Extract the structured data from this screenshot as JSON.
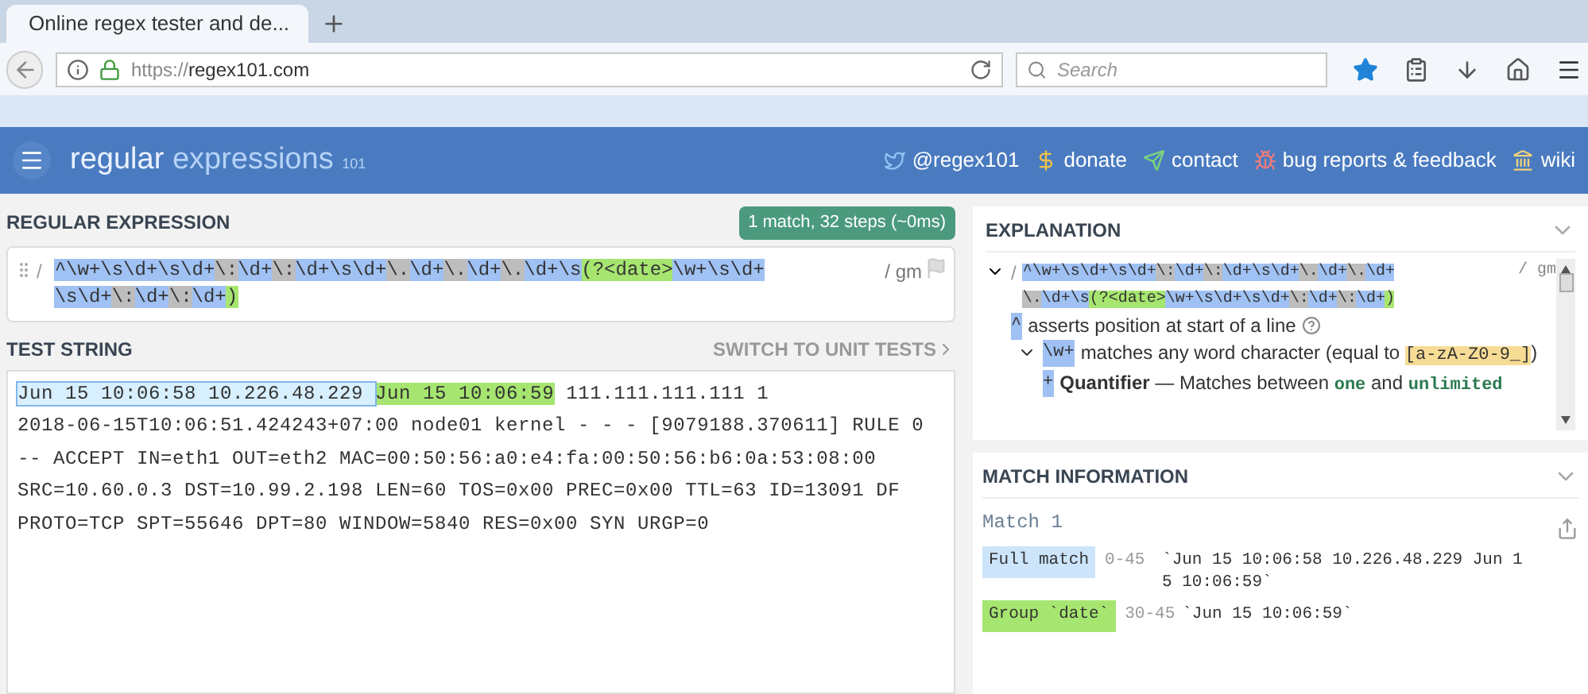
{
  "browser": {
    "tab_title": "Online regex tester and de...",
    "url_prefix": "https://",
    "url_host": "regex101.com",
    "search_placeholder": "Search"
  },
  "header": {
    "logo": [
      "regular",
      "expressions",
      "101"
    ],
    "links": [
      {
        "kind": "twitter",
        "label": "@regex101"
      },
      {
        "kind": "donate",
        "label": "donate"
      },
      {
        "kind": "contact",
        "label": "contact"
      },
      {
        "kind": "bug",
        "label": "bug reports & feedback"
      },
      {
        "kind": "wiki",
        "label": "wiki"
      }
    ]
  },
  "regex_panel": {
    "title": "REGULAR EXPRESSION",
    "status": "1 match, 32 steps (~0ms)",
    "delimiter": "/",
    "flags": "/ gm",
    "lines": [
      [
        {
          "kind": "token",
          "text": "^\\w+\\s\\d+\\s\\d+"
        },
        {
          "kind": "escape",
          "text": "\\:"
        },
        {
          "kind": "token",
          "text": "\\d+"
        },
        {
          "kind": "escape",
          "text": "\\:"
        },
        {
          "kind": "token",
          "text": "\\d+\\s\\d+"
        },
        {
          "kind": "escape",
          "text": "\\."
        },
        {
          "kind": "token",
          "text": "\\d+"
        },
        {
          "kind": "escape",
          "text": "\\."
        },
        {
          "kind": "token",
          "text": "\\d+"
        },
        {
          "kind": "escape",
          "text": "\\."
        },
        {
          "kind": "token",
          "text": "\\d+\\s"
        },
        {
          "kind": "group",
          "text": "(?<date>"
        },
        {
          "kind": "token",
          "text": "\\w+\\s\\d+"
        }
      ],
      [
        {
          "kind": "token",
          "text": "\\s\\d+"
        },
        {
          "kind": "escape",
          "text": "\\:"
        },
        {
          "kind": "token",
          "text": "\\d+"
        },
        {
          "kind": "escape",
          "text": "\\:"
        },
        {
          "kind": "token",
          "text": "\\d+"
        },
        {
          "kind": "group",
          "text": ")"
        }
      ]
    ]
  },
  "test_panel": {
    "title": "TEST STRING",
    "switch_label": "SWITCH TO UNIT TESTS",
    "lines": [
      [
        {
          "kind": "full",
          "text": "Jun 15 10:06:58 10.226.48.229 "
        },
        {
          "kind": "group",
          "text": "Jun 15 10:06:59"
        },
        {
          "kind": "plain",
          "text": " 111.111.111.111 1"
        }
      ],
      [
        {
          "kind": "plain",
          "text": "2018-06-15T10:06:51.424243+07:00 node01 kernel - - - [9079188.370611] RULE 0"
        }
      ],
      [
        {
          "kind": "plain",
          "text": "-- ACCEPT IN=eth1 OUT=eth2 MAC=00:50:56:a0:e4:fa:00:50:56:b6:0a:53:08:00"
        }
      ],
      [
        {
          "kind": "plain",
          "text": "SRC=10.60.0.3 DST=10.99.2.198 LEN=60 TOS=0x00 PREC=0x00 TTL=63 ID=13091 DF"
        }
      ],
      [
        {
          "kind": "plain",
          "text": "PROTO=TCP SPT=55646 DPT=80 WINDOW=5840 RES=0x00 SYN URGP=0"
        }
      ]
    ]
  },
  "explanation": {
    "title": "EXPLANATION",
    "delimiter": "/",
    "flags": "/ gm",
    "lines": [
      [
        {
          "kind": "token",
          "text": "^\\w+\\s\\d+\\s\\d+"
        },
        {
          "kind": "escape",
          "text": "\\:"
        },
        {
          "kind": "token",
          "text": "\\d+"
        },
        {
          "kind": "escape",
          "text": "\\:"
        },
        {
          "kind": "token",
          "text": "\\d+\\s\\d+"
        },
        {
          "kind": "escape",
          "text": "\\."
        },
        {
          "kind": "token",
          "text": "\\d+"
        },
        {
          "kind": "escape",
          "text": "\\."
        },
        {
          "kind": "token",
          "text": "\\d+"
        }
      ],
      [
        {
          "kind": "escape",
          "text": "\\."
        },
        {
          "kind": "token",
          "text": "\\d+\\s"
        },
        {
          "kind": "group",
          "text": "(?<date>"
        },
        {
          "kind": "token",
          "text": "\\w+\\s\\d+\\s\\d+"
        },
        {
          "kind": "escape",
          "text": "\\:"
        },
        {
          "kind": "token",
          "text": "\\d+"
        },
        {
          "kind": "escape",
          "text": "\\:"
        },
        {
          "kind": "token",
          "text": "\\d+"
        },
        {
          "kind": "group",
          "text": ")"
        }
      ]
    ],
    "items": [
      {
        "token": "^",
        "help": true,
        "parts": [
          {
            "kind": "text",
            "text": "asserts position at start of a line"
          }
        ]
      },
      {
        "token": "\\w+",
        "expanded": true,
        "parts": [
          {
            "kind": "text",
            "text": "matches any word character (equal to "
          },
          {
            "kind": "class",
            "text": "[a-zA-Z0-9_]"
          },
          {
            "kind": "text",
            "text": ")"
          }
        ]
      },
      {
        "token": "+",
        "parts": [
          {
            "kind": "bold",
            "text": "Quantifier"
          },
          {
            "kind": "text",
            "text": " — Matches between "
          },
          {
            "kind": "code",
            "text": "one"
          },
          {
            "kind": "text",
            "text": " and "
          },
          {
            "kind": "code",
            "text": "unlimited"
          }
        ]
      }
    ]
  },
  "match_info": {
    "title": "MATCH INFORMATION",
    "match_label": "Match 1",
    "rows": [
      {
        "kind": "full",
        "label": "Full match",
        "range": "0-45",
        "value": "`Jun 15 10:06:58 10.226.48.229 Jun 15 10:06:59`"
      },
      {
        "kind": "group",
        "label": "Group `date`",
        "range": "30-45",
        "value": "`Jun 15 10:06:59`"
      }
    ]
  }
}
